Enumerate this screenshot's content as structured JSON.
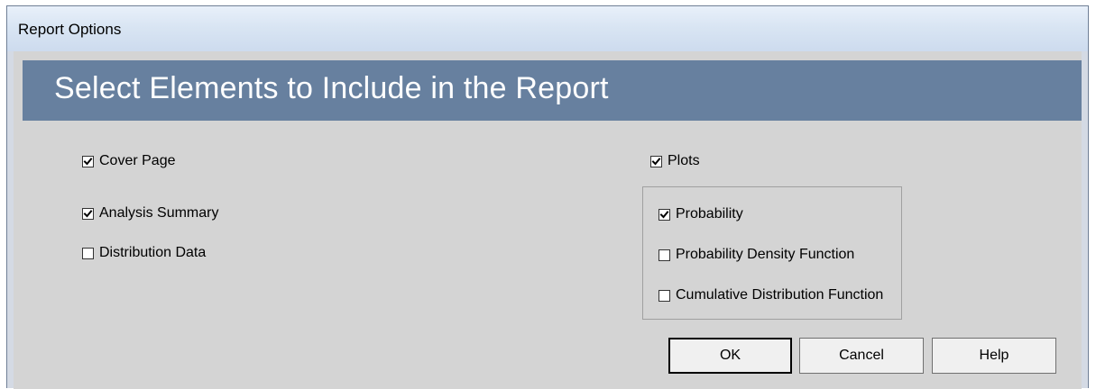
{
  "window": {
    "title": "Report Options"
  },
  "banner": {
    "heading": "Select Elements to Include in the Report"
  },
  "options": {
    "cover_page": {
      "label": "Cover Page",
      "checked": true
    },
    "analysis_summary": {
      "label": "Analysis Summary",
      "checked": true
    },
    "distribution_data": {
      "label": "Distribution Data",
      "checked": false
    },
    "plots": {
      "label": "Plots",
      "checked": true
    }
  },
  "plot_options": {
    "probability": {
      "label": "Probability",
      "checked": true
    },
    "pdf": {
      "label": "Probability Density Function",
      "checked": false
    },
    "cdf": {
      "label": "Cumulative Distribution Function",
      "checked": false
    }
  },
  "buttons": {
    "ok": "OK",
    "cancel": "Cancel",
    "help": "Help"
  },
  "colors": {
    "banner_background": "#67809f",
    "banner_text": "#ffffff",
    "client_background": "#d4d4d4"
  }
}
